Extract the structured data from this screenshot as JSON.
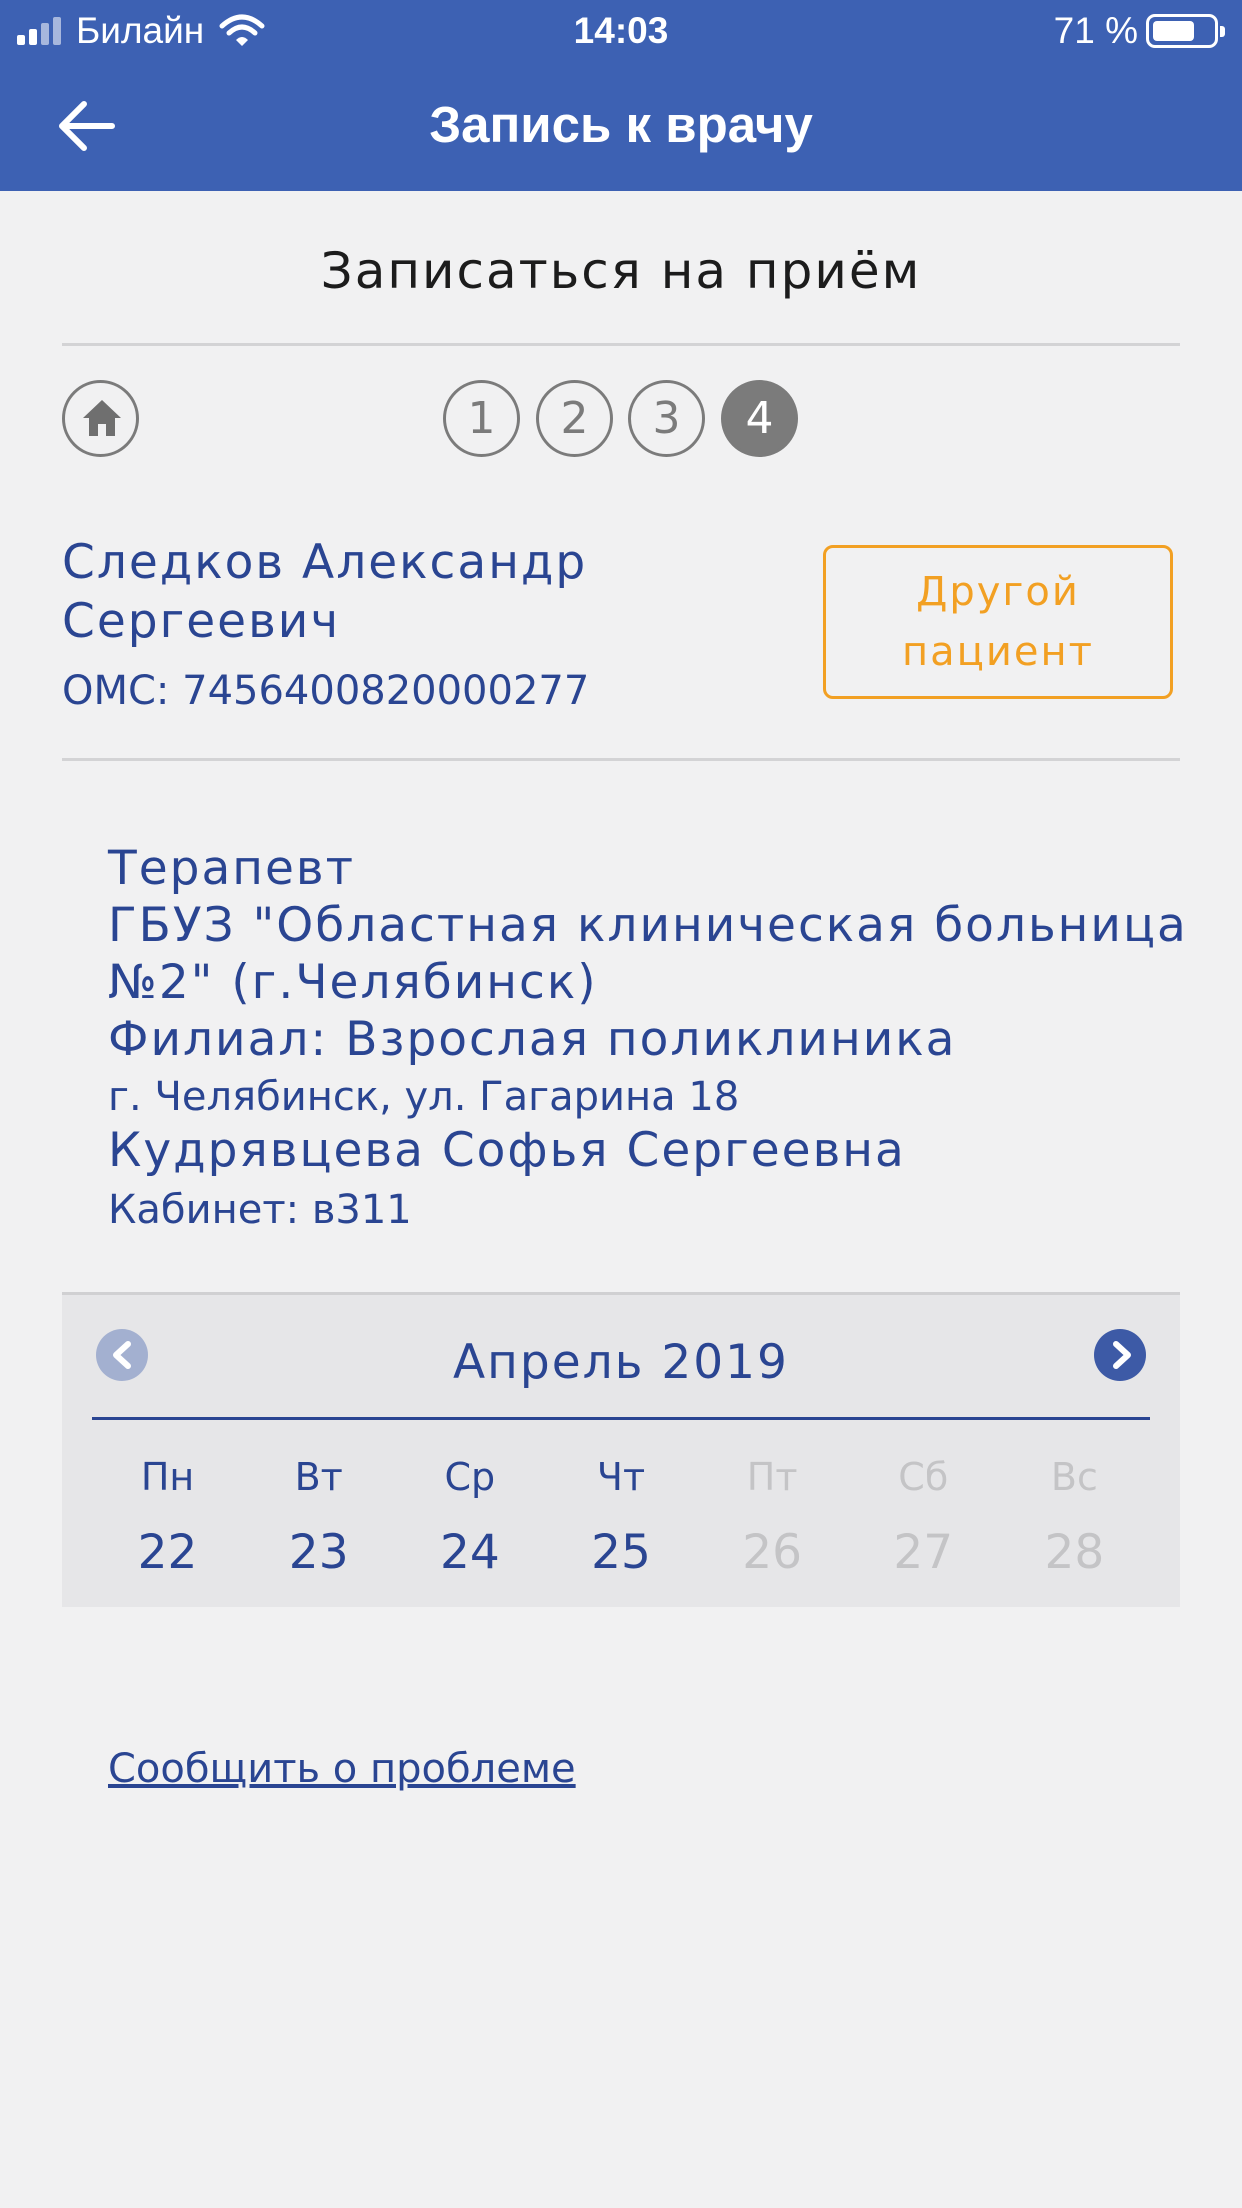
{
  "status_bar": {
    "carrier": "Билайн",
    "time": "14:03",
    "battery_percent": "71 %",
    "battery_level": 0.71
  },
  "header": {
    "title": "Запись к врачу",
    "back_icon": "arrow-left-icon"
  },
  "page": {
    "title": "Записаться на приём"
  },
  "steps": {
    "home_icon": "home-icon",
    "items": [
      "1",
      "2",
      "3",
      "4"
    ],
    "active": "4"
  },
  "patient": {
    "name": "Следков Александр Сергеевич",
    "oms": "ОМС: 7456400820000277",
    "other_patient_label": "Другой пациент"
  },
  "appointment": {
    "specialty": "Терапевт",
    "hospital": "ГБУЗ \"Областная клиническая больница №2\" (г.Челябинск)",
    "branch": "Филиал: Взрослая поликлиника",
    "address": "г. Челябинск, ул. Гагарина 18",
    "doctor": "Кудрявцева Софья Сергеевна",
    "office": "Кабинет: в311"
  },
  "calendar": {
    "month": "Апрель 2019",
    "days": [
      {
        "dow": "Пн",
        "date": "22",
        "available": true
      },
      {
        "dow": "Вт",
        "date": "23",
        "available": true
      },
      {
        "dow": "Ср",
        "date": "24",
        "available": true
      },
      {
        "dow": "Чт",
        "date": "25",
        "available": true
      },
      {
        "dow": "Пт",
        "date": "26",
        "available": false
      },
      {
        "dow": "Сб",
        "date": "27",
        "available": false
      },
      {
        "dow": "Вс",
        "date": "28",
        "available": false
      }
    ]
  },
  "footer": {
    "report_link": "Сообщить о проблеме"
  },
  "colors": {
    "header_bg": "#3d61b3",
    "text_blue": "#2a4592",
    "accent_orange": "#f2a023",
    "step_gray": "#7b7b7b",
    "disabled": "#c4c4c6"
  }
}
